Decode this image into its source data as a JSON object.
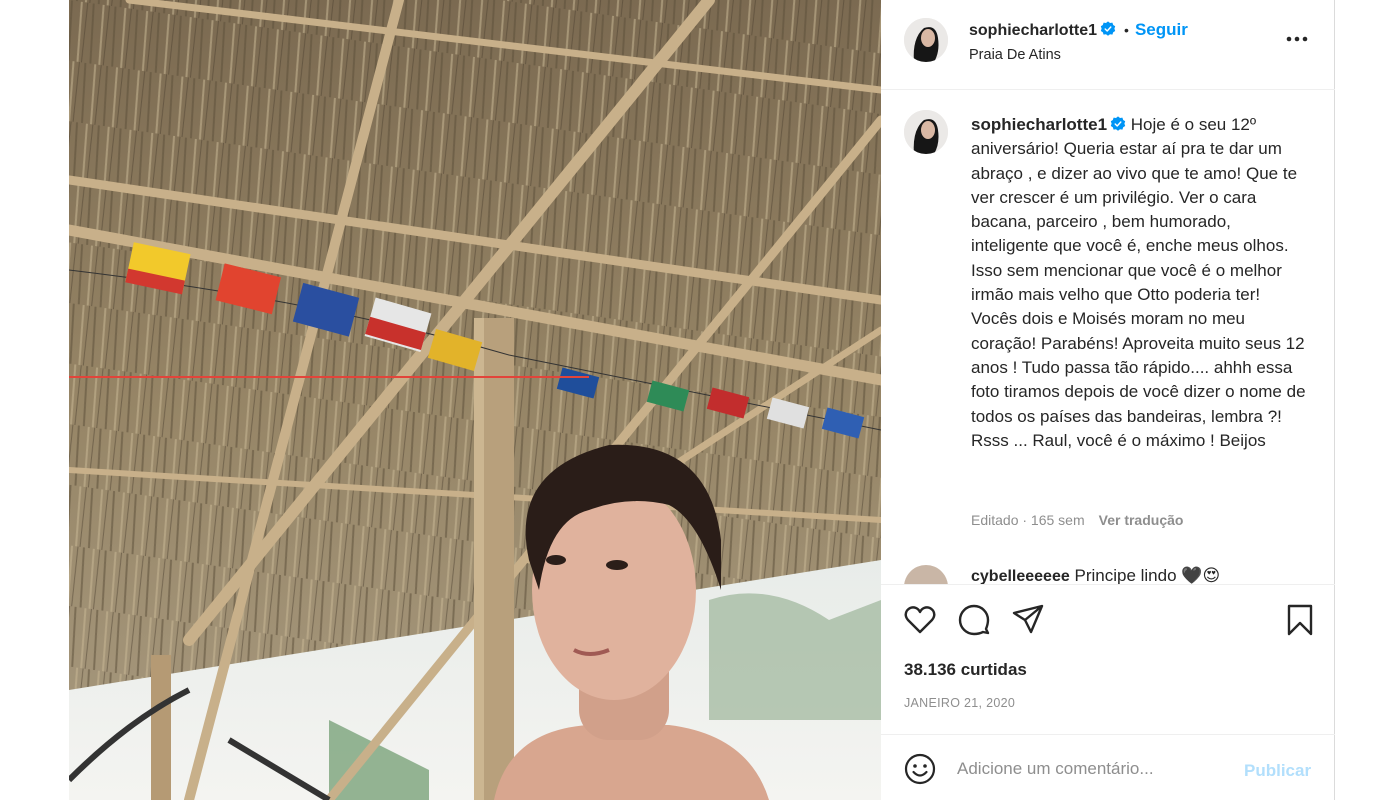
{
  "post": {
    "username": "sophiecharlotte1",
    "follow_label": "Seguir",
    "separator": "•",
    "location": "Praia De Atins",
    "caption_text": "Hoje é o seu 12º aniversário! Queria estar aí pra te dar um abraço , e dizer ao vivo que te amo! Que te ver crescer é um privilégio. Ver o cara bacana, parceiro , bem humorado, inteligente que você é, enche meus olhos. Isso sem mencionar que você é o melhor irmão mais velho que Otto poderia ter! Vocês dois e Moisés moram no meu coração! Parabéns! Aproveita muito seus 12 anos ! Tudo passa tão rápido.... ahhh essa foto tiramos depois de você dizer o nome de todos os países das bandeiras, lembra ?! Rsss ... Raul, você é o máximo ! Beijos",
    "edited_label": "Editado · 165 sem",
    "translate_label": "Ver tradução",
    "likes": "38.136 curtidas",
    "date": "JANEIRO 21, 2020"
  },
  "comment_preview": {
    "username": "cybelleeeeee",
    "text": "Principe lindo",
    "emoji": "🖤😍"
  },
  "comment_box": {
    "placeholder": "Adicione um comentário...",
    "publish_label": "Publicar"
  },
  "icons": {
    "verified": "verified-badge-icon",
    "more": "more-options-icon",
    "like": "heart-icon",
    "comment": "comment-icon",
    "share": "share-icon",
    "save": "bookmark-icon",
    "emoji": "emoji-icon"
  },
  "colors": {
    "accent": "#0095f6",
    "publish_disabled": "#b2dffc",
    "muted": "#8e8e8e",
    "text": "#262626"
  }
}
